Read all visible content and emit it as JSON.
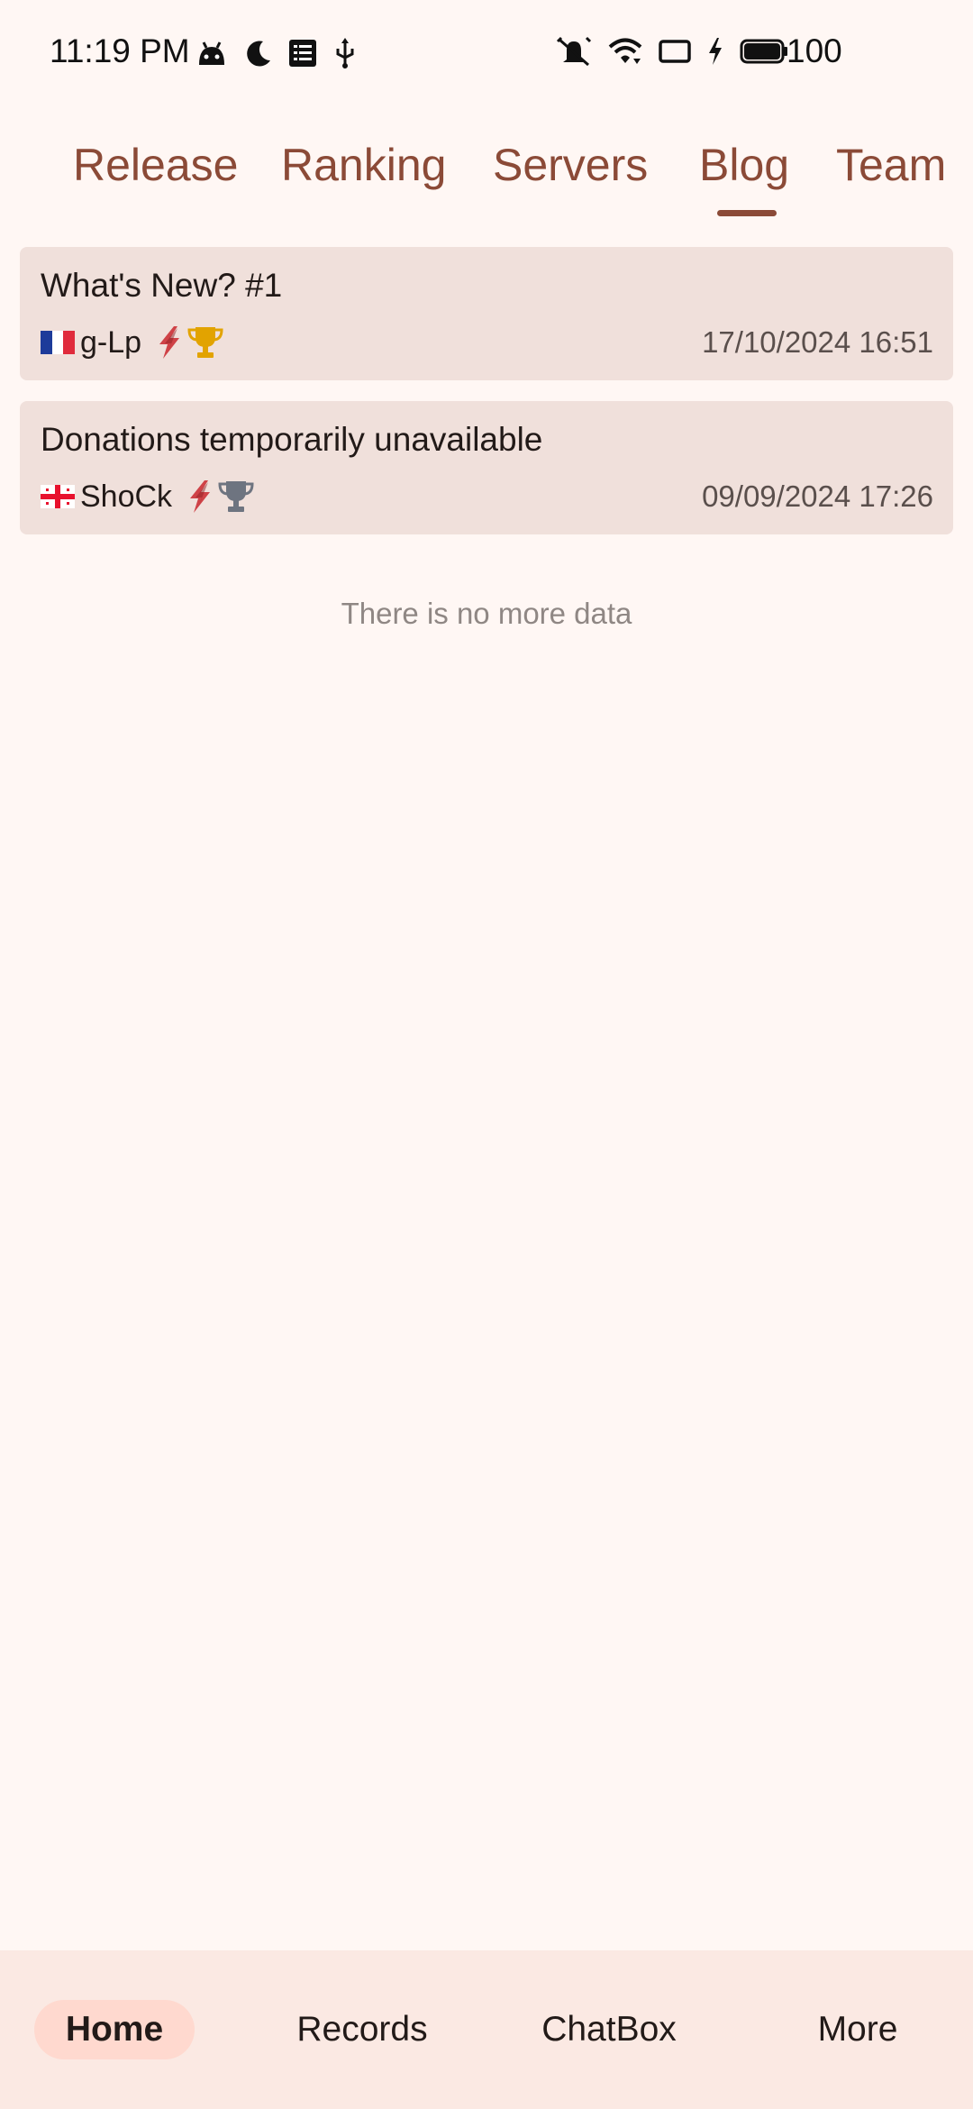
{
  "status_bar": {
    "time": "11:19 PM",
    "battery": "100",
    "left_icons": [
      "android-icon",
      "moon-icon",
      "notes-icon",
      "usb-icon"
    ],
    "right_icons": [
      "mute-icon",
      "wifi-icon",
      "cast-icon",
      "charging-icon",
      "battery-icon"
    ]
  },
  "tabs": [
    {
      "label": "Release"
    },
    {
      "label": "Ranking"
    },
    {
      "label": "Servers"
    },
    {
      "label": "Blog",
      "active": true
    },
    {
      "label": "Team"
    }
  ],
  "posts": [
    {
      "title": "What's New? #1",
      "flag": "france-flag",
      "author": "g-Lp",
      "badges": [
        "lightning-icon",
        "gold-trophy-icon"
      ],
      "date": "17/10/2024 16:51"
    },
    {
      "title": "Donations temporarily unavailable",
      "flag": "georgia-flag",
      "author": "ShoCk",
      "badges": [
        "lightning-icon",
        "silver-trophy-icon"
      ],
      "date": "09/09/2024 17:26"
    }
  ],
  "list_footer": "There is no more data",
  "bottom_nav": [
    {
      "label": "Home",
      "active": true
    },
    {
      "label": "Records"
    },
    {
      "label": "ChatBox"
    },
    {
      "label": "More"
    }
  ],
  "colors": {
    "background": "#fff7f4",
    "accent": "#8b4a37",
    "card": "#f0e0db",
    "nav_bg": "#fbe9e3",
    "nav_active_pill": "#ffd9cf",
    "gold": "#e2a300",
    "silver": "#6e7480"
  }
}
